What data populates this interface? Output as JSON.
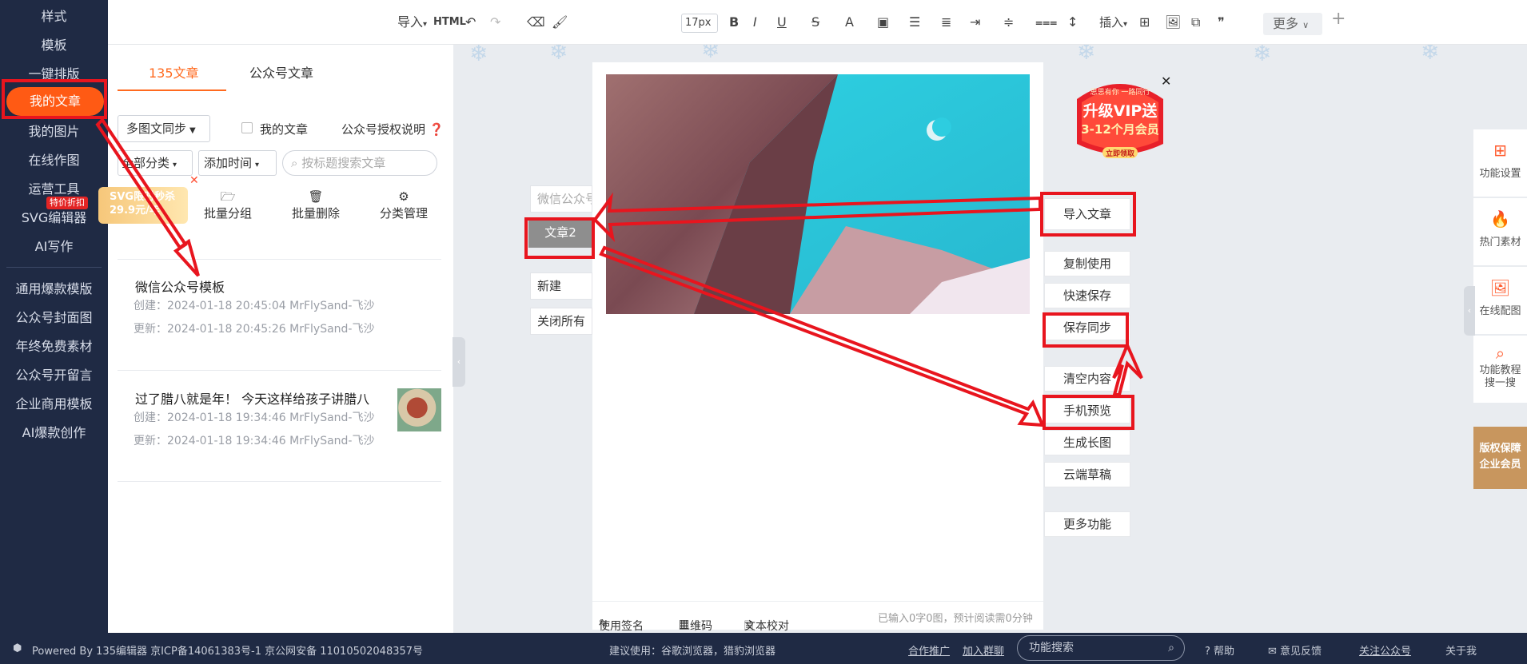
{
  "sidebar": {
    "items": [
      {
        "label": "样式"
      },
      {
        "label": "模板"
      },
      {
        "label": "一键排版"
      },
      {
        "label": "我的文章"
      },
      {
        "label": "我的图片"
      },
      {
        "label": "在线作图"
      },
      {
        "label": "运营工具"
      },
      {
        "label": "SVG编辑器"
      },
      {
        "label": "AI写作"
      },
      {
        "label": "通用爆款模版"
      },
      {
        "label": "公众号封面图"
      },
      {
        "label": "年终免费素材"
      },
      {
        "label": "公众号开留言"
      },
      {
        "label": "企业商用模板"
      },
      {
        "label": "AI爆款创作"
      }
    ],
    "badge": "特价折扣"
  },
  "panel": {
    "tabs": [
      {
        "label": "135文章"
      },
      {
        "label": "公众号文章"
      }
    ],
    "sync_dropdown": "多图文同步",
    "my_articles_label": "我的文章",
    "auth_label": "公众号授权说明",
    "category_select": "全部分类",
    "sort_select": "添加时间",
    "search_placeholder": "按标题搜索文章",
    "actions": [
      {
        "label": "批量分组"
      },
      {
        "label": "批量删除"
      },
      {
        "label": "分类管理"
      }
    ],
    "promo": {
      "line1": "SVG限时秒杀",
      "line2": "29.9元/年"
    },
    "articles": [
      {
        "title": "微信公众号模板",
        "created": "创建：2024-01-18 20:45:04  MrFlySand-飞沙",
        "updated": "更新：2024-01-18 20:45:26  MrFlySand-飞沙"
      },
      {
        "title": "过了腊八就是年！ 今天这样给孩子讲腊八",
        "created": "创建：2024-01-18 19:34:46  MrFlySand-飞沙",
        "updated": "更新：2024-01-18 19:34:46  MrFlySand-飞沙"
      }
    ]
  },
  "toolbar": {
    "import": "导入",
    "html": "HTML",
    "font_size": "17px",
    "bold": "B",
    "italic": "I",
    "underline": "U",
    "strike": "S",
    "font_color": "A",
    "insert": "插入",
    "more": "更多",
    "plus": "+"
  },
  "editor": {
    "title_input": "微信公众号",
    "article_tab": "文章2",
    "new_btn": "新建",
    "close_all": "关闭所有",
    "footer": {
      "sign": "使用签名",
      "qrcode": "二维码",
      "proof": "文本校对",
      "stats": "已输入0字0图，预计阅读需0分钟"
    }
  },
  "right_actions": [
    {
      "label": "导入文章"
    },
    {
      "label": "复制使用"
    },
    {
      "label": "快速保存"
    },
    {
      "label": "保存同步"
    },
    {
      "label": "清空内容"
    },
    {
      "label": "手机预览"
    },
    {
      "label": "生成长图"
    },
    {
      "label": "云端草稿"
    },
    {
      "label": "更多功能"
    }
  ],
  "vip_ad": {
    "top": "思思有你 一路同行",
    "main1": "升级VIP送",
    "main2": "3-12个月会员",
    "button": "立即领取"
  },
  "right_float": [
    {
      "label": "功能设置"
    },
    {
      "label": "热门素材"
    },
    {
      "label": "在线配图"
    },
    {
      "label": "功能教程\n搜一搜"
    }
  ],
  "copyright_badge": {
    "line1": "版权保障",
    "line2": "企业会员"
  },
  "footer": {
    "powered": "Powered By 135编辑器  京ICP备14061383号-1 京公网安备 11010502048357号",
    "suggest": "建议使用：谷歌浏览器，猎豹浏览器",
    "partner": "合作推广",
    "join_group": "加入群聊",
    "search_placeholder": "功能搜索",
    "help": "帮助",
    "feedback": "意见反馈",
    "follow": "关注公众号",
    "about": "关于我"
  },
  "colors": {
    "accent": "#ff6a1f",
    "sidebar_bg": "#1f2a44",
    "annotation": "#e8151e"
  }
}
